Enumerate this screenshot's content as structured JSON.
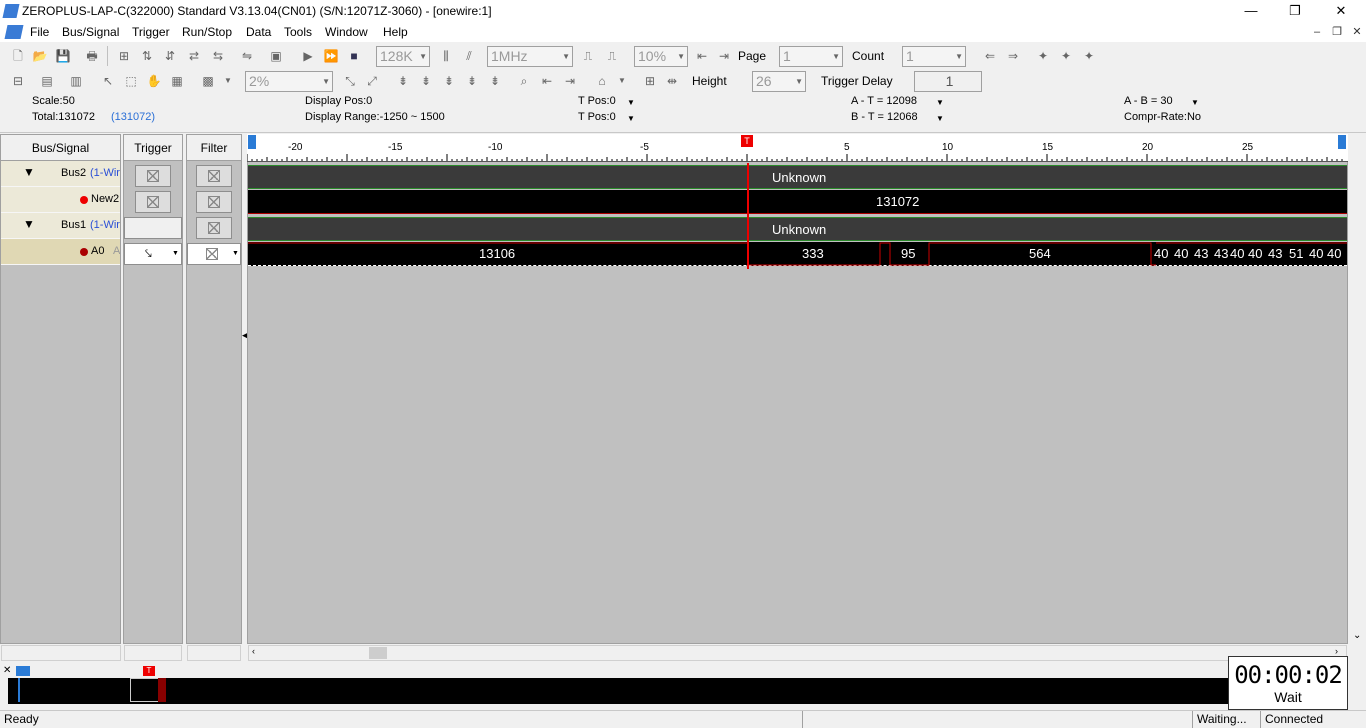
{
  "window": {
    "title": "ZEROPLUS-LAP-C(322000) Standard V3.13.04(CN01) (S/N:12071Z-3060) - [onewire:1]",
    "minimize": "—",
    "restore": "❐",
    "close": "✕"
  },
  "menu": [
    "File",
    "Bus/Signal",
    "Trigger",
    "Run/Stop",
    "Data",
    "Tools",
    "Window",
    "Help"
  ],
  "toolbar1": {
    "sample_depth": "128K",
    "sample_rate": "1MHz",
    "zoom": "10%",
    "page_label": "Page",
    "page_value": "1",
    "count_label": "Count",
    "count_value": "1"
  },
  "toolbar2": {
    "percent": "2%",
    "height_label": "Height",
    "height_value": "26",
    "trigger_delay_label": "Trigger Delay",
    "trigger_delay_value": "1"
  },
  "info": {
    "scale": "Scale:50",
    "total": "Total:131072",
    "total_paren": "(131072)",
    "display_pos": "Display Pos:0",
    "display_range": "Display Range:-1250 ~ 1500",
    "t_pos_a": "T Pos:0",
    "t_pos_b": "T Pos:0",
    "a_t": "A - T = 12098",
    "b_t": "B - T = 12068",
    "a_b": "A - B = 30",
    "compr": "Compr-Rate:No"
  },
  "headers": {
    "bus_signal": "Bus/Signal",
    "trigger": "Trigger",
    "filter": "Filter"
  },
  "signals": [
    {
      "name": "Bus2",
      "proto": "(1-Wir"
    },
    {
      "name": "New2",
      "proto": ""
    },
    {
      "name": "Bus1",
      "proto": "(1-Wir"
    },
    {
      "name": "A0",
      "proto": "A"
    }
  ],
  "ruler_ticks": [
    "-20",
    "-15",
    "-10",
    "-5",
    "0",
    "5",
    "10",
    "15",
    "20",
    "25"
  ],
  "trigger_marker": "T",
  "lanes": {
    "bus2_unknown": "Unknown",
    "new2_value": "131072",
    "bus1_unknown": "Unknown",
    "a0_values": [
      "13106",
      "333",
      "95",
      "564",
      "40",
      "40",
      "43",
      "43",
      "40",
      "40",
      "43",
      "51",
      "40",
      "40"
    ]
  },
  "timer": {
    "time": "00:00:02",
    "state": "Wait"
  },
  "status": {
    "ready": "Ready",
    "waiting": "Waiting...",
    "connected": "Connected"
  }
}
